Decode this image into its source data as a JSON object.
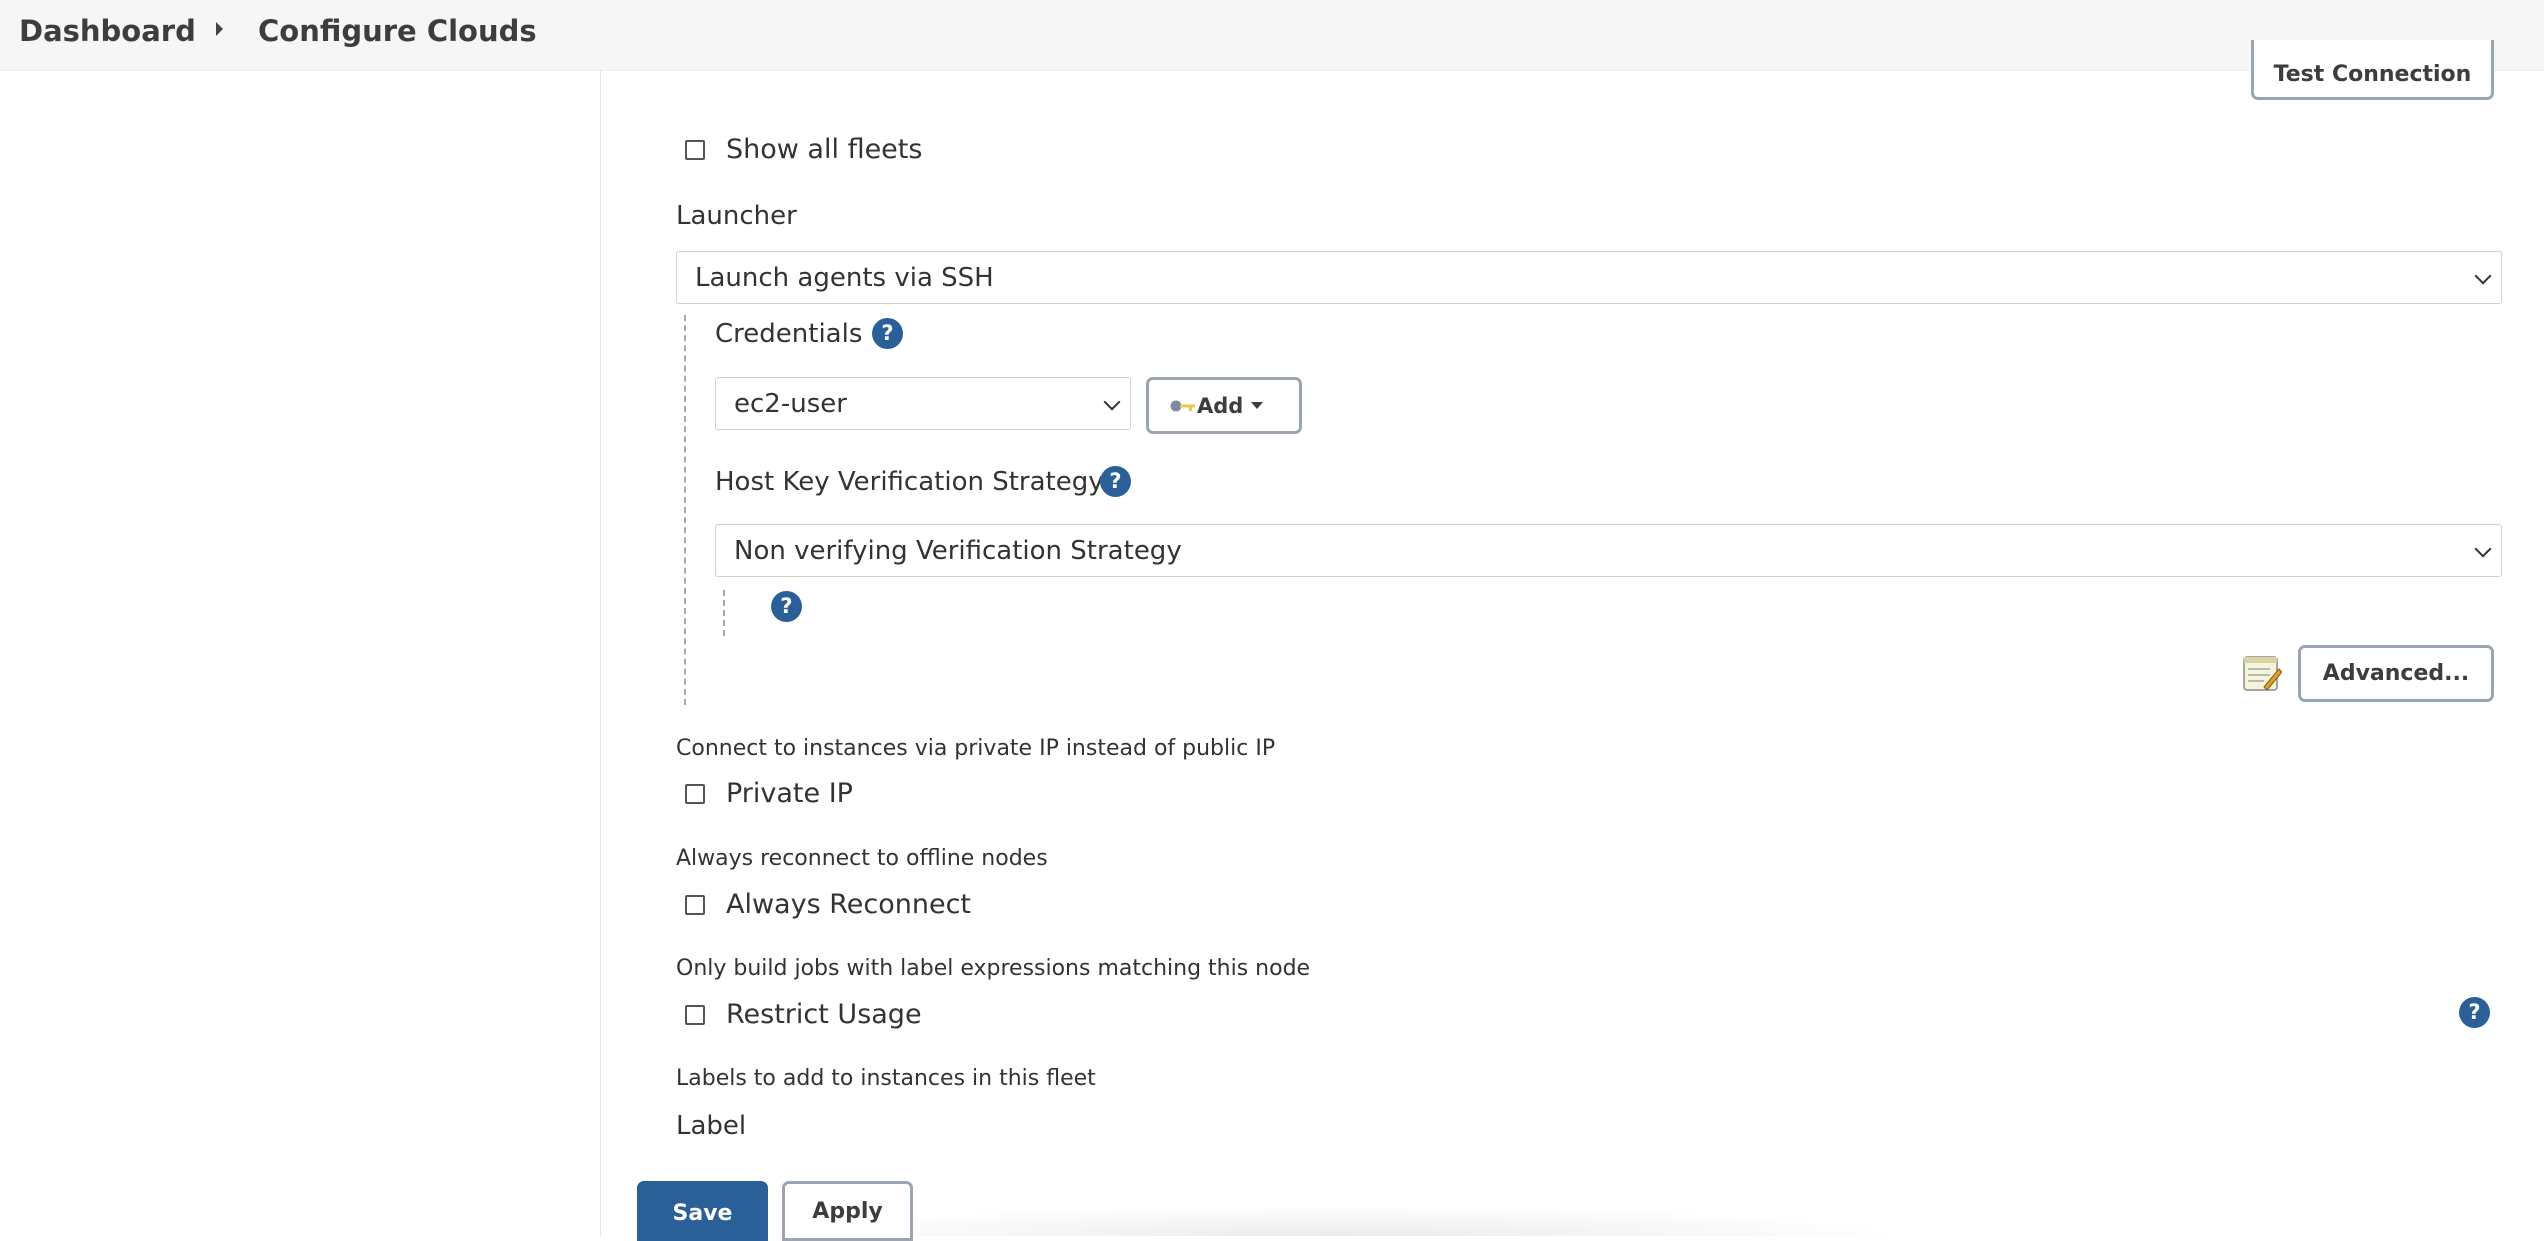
{
  "breadcrumb": {
    "home": "Dashboard",
    "current": "Configure Clouds"
  },
  "buttons": {
    "test_connection": "Test Connection",
    "add": "Add",
    "advanced": "Advanced...",
    "save": "Save",
    "apply": "Apply"
  },
  "show_all_fleets": {
    "label": "Show all fleets",
    "checked": false
  },
  "launcher": {
    "title": "Launcher",
    "selected": "Launch agents via SSH",
    "credentials": {
      "title": "Credentials",
      "selected": "ec2-user"
    },
    "host_key": {
      "title": "Host Key Verification Strategy",
      "selected": "Non verifying Verification Strategy"
    }
  },
  "private_ip": {
    "description": "Connect to instances via private IP instead of public IP",
    "label": "Private IP",
    "checked": false
  },
  "always_reconnect": {
    "description": "Always reconnect to offline nodes",
    "label": "Always Reconnect",
    "checked": false
  },
  "restrict_usage": {
    "description": "Only build jobs with label expressions matching this node",
    "label": "Restrict Usage",
    "checked": false
  },
  "labels": {
    "description": "Labels to add to instances in this fleet",
    "title": "Label"
  },
  "colors": {
    "primary": "#2a6097",
    "help_icon": "#2a6097",
    "button_border": "#9aa5b1"
  },
  "icons": [
    "chevron-right-icon",
    "help-icon",
    "chevron-down-icon",
    "key-icon",
    "caret-down-icon",
    "notepad-icon"
  ]
}
